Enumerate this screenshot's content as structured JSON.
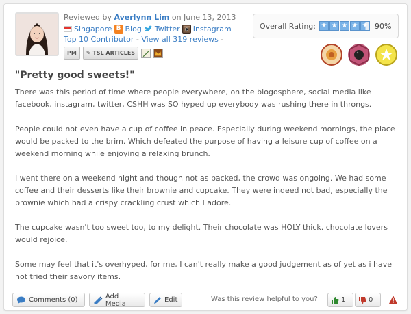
{
  "reviewer": {
    "prefix": "Reviewed by",
    "name": "Averlynn Lim",
    "date_prefix": "on June 13, 2013",
    "location": "Singapore",
    "blog_label": "Blog",
    "twitter_label": "Twitter",
    "instagram_label": "Instagram",
    "contributor": "Top 10 Contributor",
    "reviews_link": "View all 319 reviews",
    "pm_label": "PM",
    "tsl_label": "TSL ARTICLES",
    "separator": "-"
  },
  "rating": {
    "label": "Overall Rating:",
    "percent": "90%",
    "value": 0.9,
    "star_color": "#7ab3e8"
  },
  "review": {
    "title": "\"Pretty good sweets!\"",
    "paragraphs": [
      "There was this period of time where people everywhere, on the blogosphere, social media like facebook, instagram, twitter, CSHH was SO hyped up everybody was rushing there in throngs.",
      "People could not even have a cup of coffee in peace. Especially during weekend mornings, the place would be packed to the brim. Which defeated the purpose of having a leisure cup of coffee on a weekend morning while enjoying a relaxing brunch.",
      "I went there on a weekend night and though not as packed, the crowd was ongoing. We had some coffee and their desserts like their brownie and cupcake. They were indeed not bad, especially the brownie which had a crispy crackling crust which I adore.",
      "The cupcake wasn't too sweet too, to my delight. Their chocolate was HOLY thick. chocolate lovers would rejoice.",
      "Some may feel that it's overhyped, for me, I can't really make a good judgement as of yet as i have not tried their savory items."
    ]
  },
  "footer": {
    "comments_label": "Comments (0)",
    "add_media_label": "Add Media",
    "edit_label": "Edit",
    "helpful_question": "Was this review helpful to you?",
    "up_count": "1",
    "down_count": "0"
  },
  "colors": {
    "link": "#3a7dc4",
    "thumb_up": "#2f8a2f",
    "thumb_down": "#c0392b"
  }
}
